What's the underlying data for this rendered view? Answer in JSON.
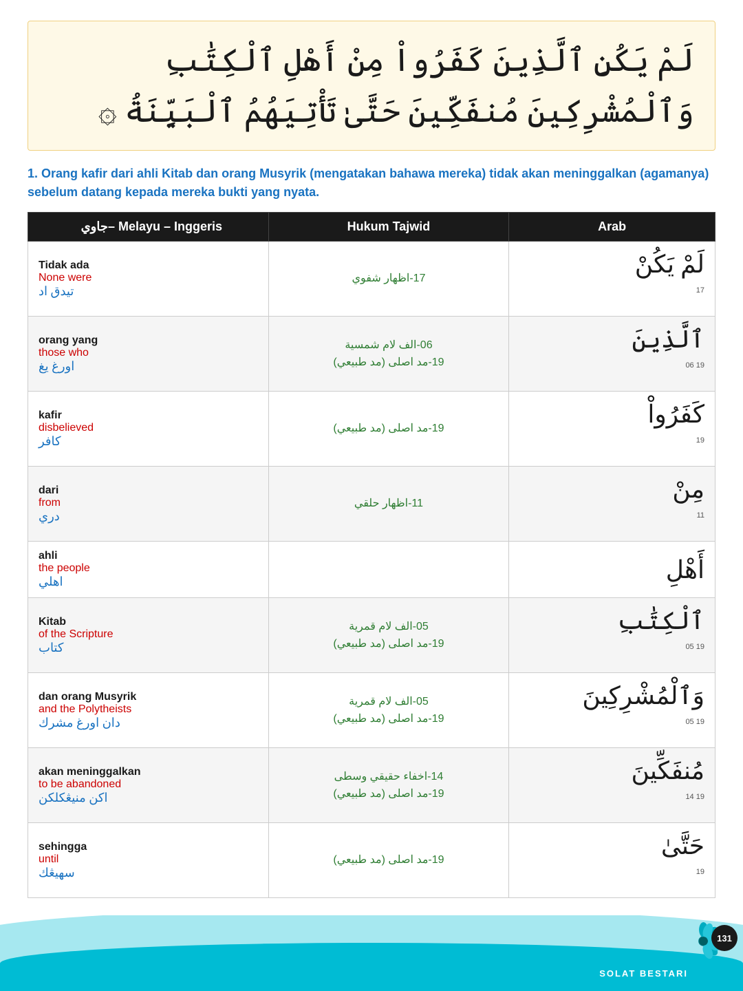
{
  "page": {
    "number": "131",
    "footer_text": "SOLAT BESTARI"
  },
  "arabic_verse": {
    "text": "لَمْ يَكُنِ ٱلَّذِينَ كَفَرُواْ مِنْ أَهْلِ ٱلْكِتَٰبِ وَٱلْمُشْرِكِينَ مُنفَكِّينَ حَتَّىٰ تَأْتِيَهُمُ ٱلْبَيِّنَةُ ۞"
  },
  "translation": {
    "text": "1. Orang kafir dari ahli Kitab dan orang Musyrik (mengatakan bahawa mereka) tidak akan meninggalkan (agamanya) sebelum datang kepada mereka bukti yang nyata."
  },
  "table": {
    "headers": {
      "melayu": "Melayu – Inggeris",
      "melayu_jawi": "جاوي–",
      "tajwid": "Hukum Tajwid",
      "arab": "Arab"
    },
    "rows": [
      {
        "melayu_bm": "Tidak ada",
        "melayu_en": "None were",
        "melayu_jawi": "تيدق اد",
        "tajwid": "17-اظهار شفوي",
        "arab_text": "لَمْ يَكُنْ",
        "arab_num": "17"
      },
      {
        "melayu_bm": "orang yang",
        "melayu_en": "those who",
        "melayu_jawi": "اورغ يغ",
        "tajwid": "06-الف لام شمسية\n19-مد اصلى (مد طبيعي)",
        "arab_text": "ٱلَّذِينَ",
        "arab_num": "19   06"
      },
      {
        "melayu_bm": "kafir",
        "melayu_en": "disbelieved",
        "melayu_jawi": "كافر",
        "tajwid": "19-مد اصلى (مد طبيعي)",
        "arab_text": "كَفَرُواْ",
        "arab_num": "19"
      },
      {
        "melayu_bm": "dari",
        "melayu_en": "from",
        "melayu_jawi": "دري",
        "tajwid": "11-اظهار حلقي",
        "arab_text": "مِنْ",
        "arab_num": "11"
      },
      {
        "melayu_bm": "ahli",
        "melayu_en": "the people",
        "melayu_jawi": "اهلي",
        "tajwid": "",
        "arab_text": "أَهْلِ",
        "arab_num": ""
      },
      {
        "melayu_bm": "Kitab",
        "melayu_en": "of the Scripture",
        "melayu_jawi": "كتاب",
        "tajwid": "05-الف لام قمرية\n19-مد اصلى (مد طبيعي)",
        "arab_text": "ٱلْكِتَٰبِ",
        "arab_num": "19   05"
      },
      {
        "melayu_bm": "dan orang Musyrik",
        "melayu_en": "and the Polytheists",
        "melayu_jawi": "دان اورغ مشرك",
        "tajwid": "05-الف لام قمرية\n19-مد اصلى (مد طبيعي)",
        "arab_text": "وَٱلْمُشْرِكِينَ",
        "arab_num": "19   05"
      },
      {
        "melayu_bm": "akan meninggalkan",
        "melayu_en": "to be abandoned",
        "melayu_jawi": "اكن منيڠكلكن",
        "tajwid": "14-اخفاء حقيقي وسطى\n19-مد اصلى (مد طبيعي)",
        "arab_text": "مُنفَكِّينَ",
        "arab_num": "19   14"
      },
      {
        "melayu_bm": "sehingga",
        "melayu_en": "until",
        "melayu_jawi": "سهيڠك",
        "tajwid": "19-مد اصلى (مد طبيعي)",
        "arab_text": "حَتَّىٰ",
        "arab_num": "19"
      }
    ]
  }
}
